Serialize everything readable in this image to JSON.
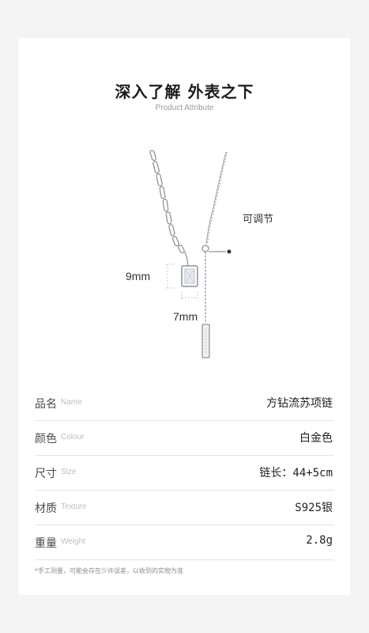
{
  "header": {
    "title": "深入了解 外表之下",
    "subtitle": "Product Attribute"
  },
  "product_image": {
    "height_dimension": "9mm",
    "width_dimension": "7mm",
    "adjustable_label": "可调节"
  },
  "attributes": [
    {
      "label_cn": "品名",
      "label_en": "Name",
      "value": "方钻流苏项链"
    },
    {
      "label_cn": "颜色",
      "label_en": "Colour",
      "value": "白金色"
    },
    {
      "label_cn": "尺寸",
      "label_en": "Size",
      "value": "链长：44+5cm"
    },
    {
      "label_cn": "材质",
      "label_en": "Texture",
      "value": "S925银"
    },
    {
      "label_cn": "重量",
      "label_en": "Weight",
      "value": "2.8g"
    }
  ],
  "footnote": "*手工测量，可能会存在少许误差，以收到的实物为准",
  "colors": {
    "background": "#f4f4f4",
    "card": "#ffffff",
    "divider": "#e4e4e4",
    "silver": "#9aa0a6"
  }
}
